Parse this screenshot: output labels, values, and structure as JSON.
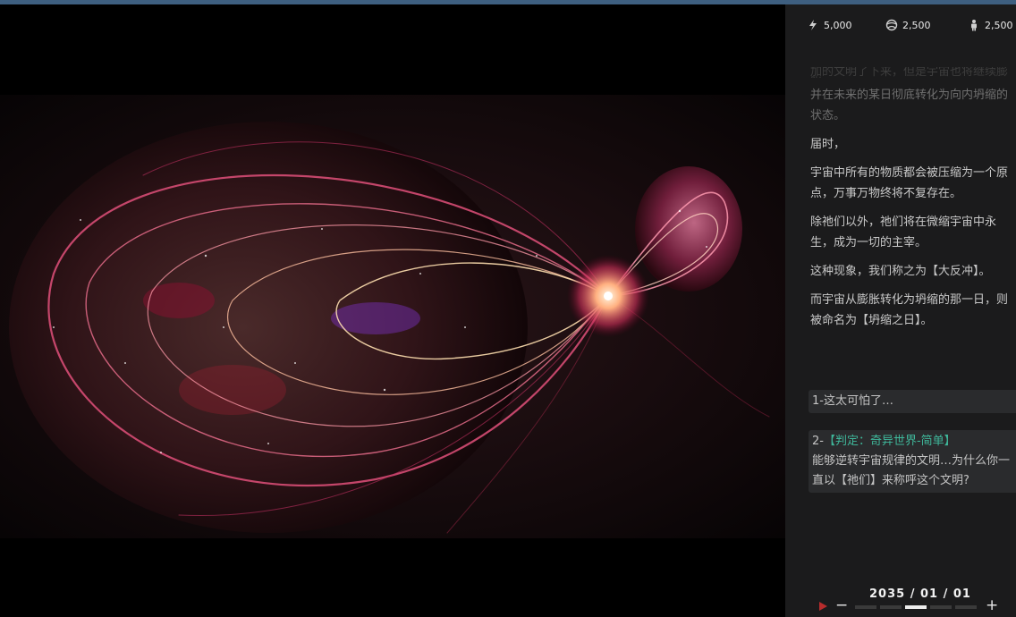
{
  "resources": [
    {
      "icon": "energy-icon",
      "value": "5,000"
    },
    {
      "icon": "globe-icon",
      "value": "2,500"
    },
    {
      "icon": "population-icon",
      "value": "2,500"
    }
  ],
  "story": {
    "cut_line": "加的文明了下来，但是宇宙也将继续膨胀",
    "paragraphs": [
      "并在未来的某日彻底转化为向内坍缩的状态。",
      "届时，",
      "宇宙中所有的物质都会被压缩为一个原点，万事万物终将不复存在。",
      "除祂们以外，祂们将在微缩宇宙中永生，成为一切的主宰。",
      "这种现象，我们称之为【大反冲】。",
      "而宇宙从膨胀转化为坍缩的那一日，则被命名为【坍缩之日】。"
    ]
  },
  "choices": {
    "c1": {
      "text": "1-这太可怕了…"
    },
    "c2": {
      "prefix": "2-",
      "tag": "【判定：奇异世界-简单】",
      "text": "能够逆转宇宙规律的文明…为什么你一直以【祂们】来称呼这个文明?"
    }
  },
  "timebar": {
    "date": "2035 / 01 / 01",
    "minus": "−",
    "plus": "+",
    "speed_level": 3,
    "speed_max": 5
  },
  "colors": {
    "accent_teal": "#3fb79a",
    "play_red": "#b72c2c",
    "topline": "#3e5f80"
  }
}
